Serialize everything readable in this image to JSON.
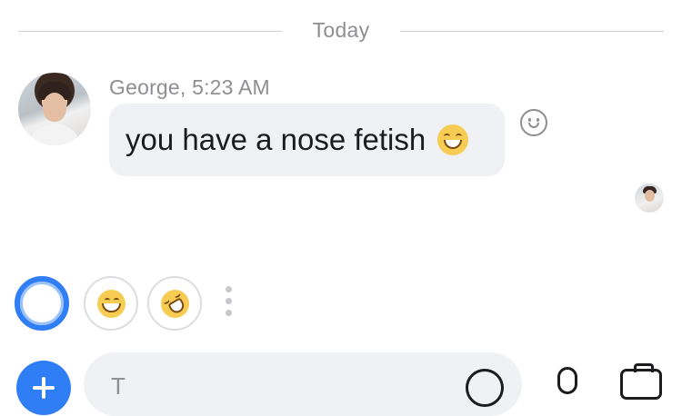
{
  "date_divider": {
    "label": "Today"
  },
  "message": {
    "sender": "George",
    "time": "5:23 AM",
    "meta": "George, 5:23 AM",
    "text": "you have a nose fetish",
    "emoji": "smiling-face-with-smiling-eyes"
  },
  "quick_reactions": {
    "items": [
      {
        "name": "active-reaction-ring"
      },
      {
        "name": "grinning-face"
      },
      {
        "name": "rolling-on-floor-laughing"
      }
    ]
  },
  "composer": {
    "placeholder": "T"
  },
  "colors": {
    "accent": "#2f7ef5",
    "bubble": "#f0f1f4",
    "meta_text": "#8e8e93",
    "emoji_yellow": "#f6cc52"
  }
}
